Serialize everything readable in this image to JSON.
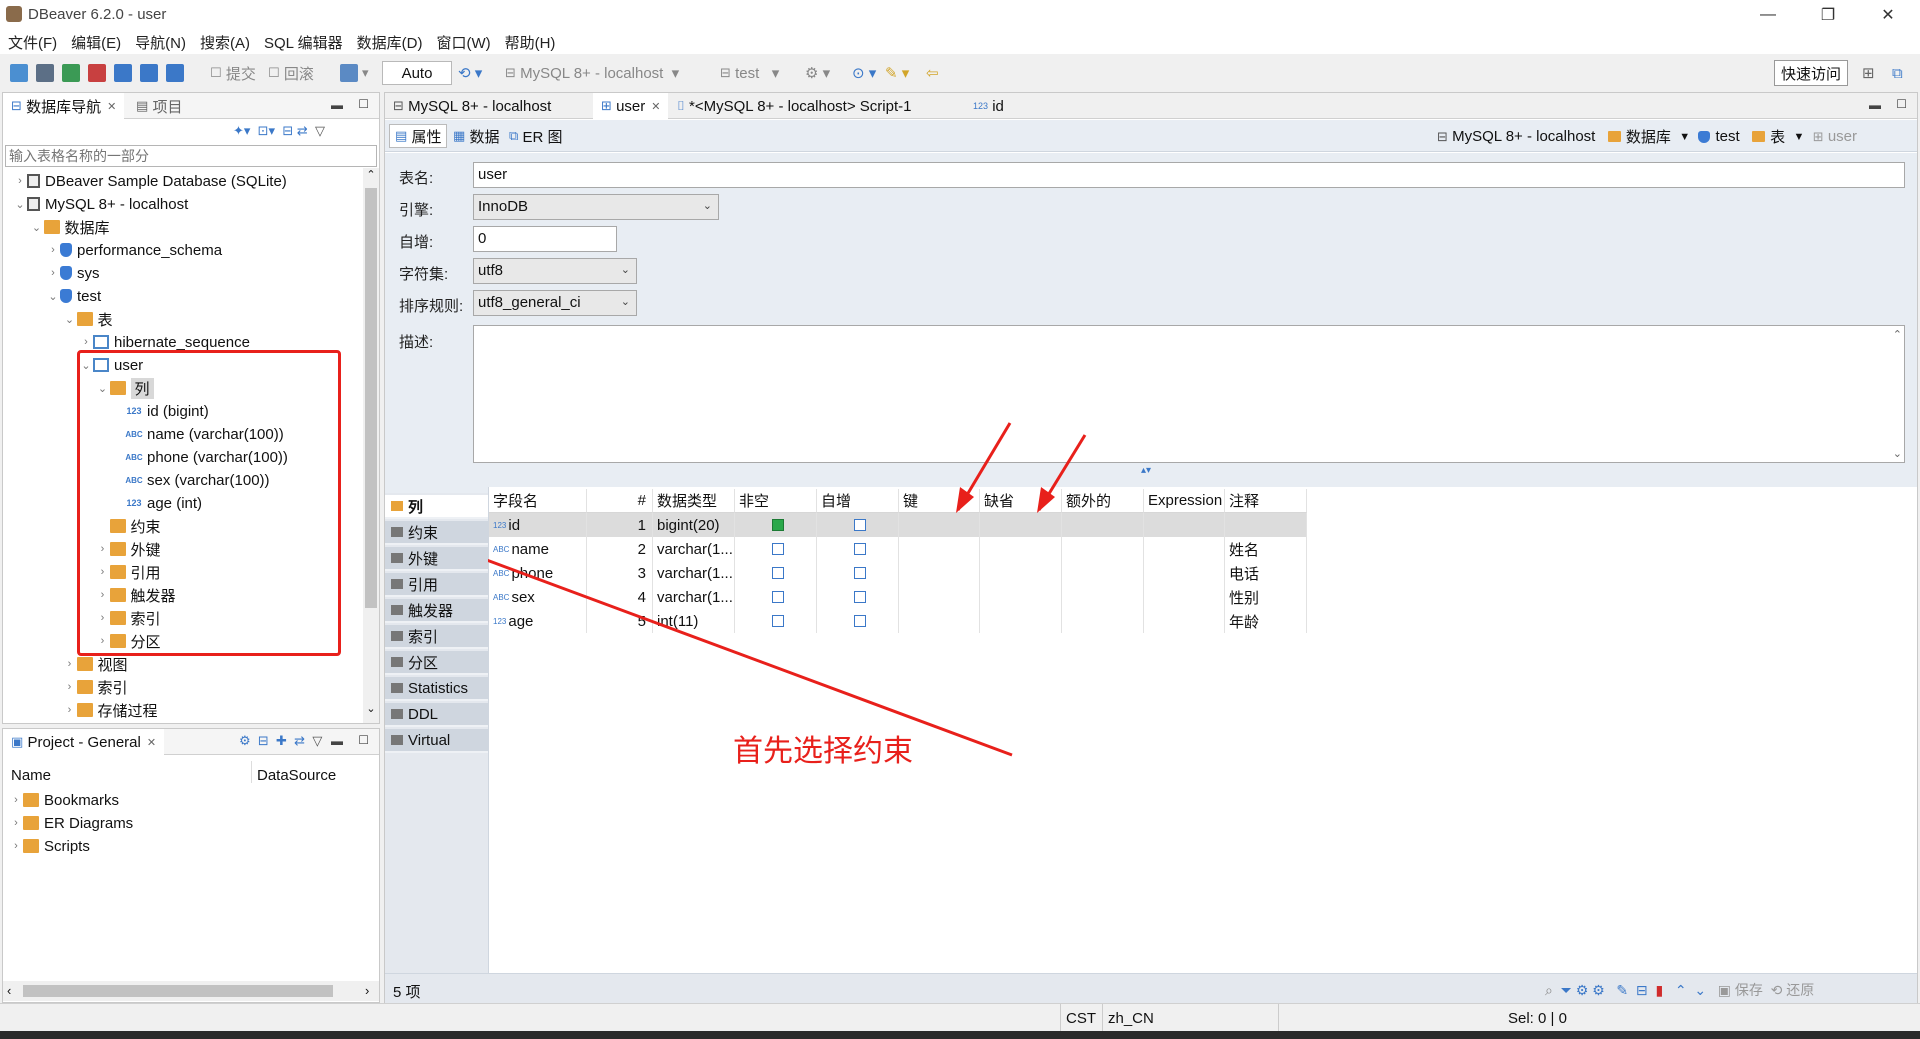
{
  "window": {
    "title": "DBeaver 6.2.0 - user"
  },
  "menu": [
    "文件(F)",
    "编辑(E)",
    "导航(N)",
    "搜索(A)",
    "SQL 编辑器",
    "数据库(D)",
    "窗口(W)",
    "帮助(H)"
  ],
  "toolbar": {
    "commit": "提交",
    "rollback": "回滚",
    "mode": "Auto",
    "connection": "MySQL 8+ - localhost",
    "database": "test",
    "quick_access": "快速访问"
  },
  "navigator": {
    "tab_label": "数据库导航",
    "project_tab": "项目",
    "filter_placeholder": "输入表格名称的一部分",
    "tree": [
      {
        "label": "DBeaver Sample Database (SQLite)",
        "level": 0,
        "arrow": "›",
        "icon": "conn"
      },
      {
        "label": "MySQL 8+ - localhost",
        "level": 0,
        "arrow": "⌄",
        "icon": "conn"
      },
      {
        "label": "数据库",
        "level": 1,
        "arrow": "⌄",
        "icon": "folder"
      },
      {
        "label": "performance_schema",
        "level": 2,
        "arrow": "›",
        "icon": "db"
      },
      {
        "label": "sys",
        "level": 2,
        "arrow": "›",
        "icon": "db"
      },
      {
        "label": "test",
        "level": 2,
        "arrow": "⌄",
        "icon": "db"
      },
      {
        "label": "表",
        "level": 3,
        "arrow": "⌄",
        "icon": "folder"
      },
      {
        "label": "hibernate_sequence",
        "level": 4,
        "arrow": "›",
        "icon": "table"
      },
      {
        "label": "user",
        "level": 4,
        "arrow": "⌄",
        "icon": "table"
      },
      {
        "label": "列",
        "level": 5,
        "arrow": "⌄",
        "icon": "folder"
      },
      {
        "label": "id (bigint)",
        "level": 6,
        "arrow": "",
        "icon": "num"
      },
      {
        "label": "name (varchar(100))",
        "level": 6,
        "arrow": "",
        "icon": "abc"
      },
      {
        "label": "phone (varchar(100))",
        "level": 6,
        "arrow": "",
        "icon": "abc"
      },
      {
        "label": "sex (varchar(100))",
        "level": 6,
        "arrow": "",
        "icon": "abc"
      },
      {
        "label": "age (int)",
        "level": 6,
        "arrow": "",
        "icon": "num"
      },
      {
        "label": "约束",
        "level": 5,
        "arrow": "",
        "icon": "folder"
      },
      {
        "label": "外键",
        "level": 5,
        "arrow": "›",
        "icon": "folder"
      },
      {
        "label": "引用",
        "level": 5,
        "arrow": "›",
        "icon": "folder"
      },
      {
        "label": "触发器",
        "level": 5,
        "arrow": "›",
        "icon": "folder"
      },
      {
        "label": "索引",
        "level": 5,
        "arrow": "›",
        "icon": "folder"
      },
      {
        "label": "分区",
        "level": 5,
        "arrow": "›",
        "icon": "folder"
      },
      {
        "label": "视图",
        "level": 3,
        "arrow": "›",
        "icon": "folder"
      },
      {
        "label": "索引",
        "level": 3,
        "arrow": "›",
        "icon": "folder"
      },
      {
        "label": "存储过程",
        "level": 3,
        "arrow": "›",
        "icon": "folder"
      }
    ]
  },
  "project": {
    "tab_label": "Project - General",
    "col_name": "Name",
    "col_datasource": "DataSource",
    "items": [
      "Bookmarks",
      "ER Diagrams",
      "Scripts"
    ]
  },
  "editor_tabs": [
    "MySQL 8+ - localhost",
    "user",
    "*<MySQL 8+ - localhost> Script-1",
    "id"
  ],
  "sub_tabs": [
    "属性",
    "数据",
    "ER 图"
  ],
  "breadcrumb": [
    "MySQL 8+ - localhost",
    "数据库",
    "test",
    "表",
    "user"
  ],
  "props": {
    "table_name_label": "表名:",
    "table_name": "user",
    "engine_label": "引擎:",
    "engine": "InnoDB",
    "autoinc_label": "自增:",
    "autoinc": "0",
    "charset_label": "字符集:",
    "charset": "utf8",
    "collation_label": "排序规则:",
    "collation": "utf8_general_ci",
    "desc_label": "描述:"
  },
  "side_tabs": [
    "列",
    "约束",
    "外键",
    "引用",
    "触发器",
    "索引",
    "分区",
    "Statistics",
    "DDL",
    "Virtual"
  ],
  "columns_grid": {
    "headers": [
      "字段名",
      "#",
      "数据类型",
      "非空",
      "自增",
      "键",
      "缺省",
      "额外的",
      "Expression",
      "注释"
    ],
    "rows": [
      {
        "name": "id",
        "num": "1",
        "type": "bigint(20)",
        "notnull": true,
        "autoinc": false,
        "comment": "",
        "icon": "123"
      },
      {
        "name": "name",
        "num": "2",
        "type": "varchar(1...",
        "notnull": false,
        "autoinc": false,
        "comment": "姓名",
        "icon": "ABC"
      },
      {
        "name": "phone",
        "num": "3",
        "type": "varchar(1...",
        "notnull": false,
        "autoinc": false,
        "comment": "电话",
        "icon": "ABC"
      },
      {
        "name": "sex",
        "num": "4",
        "type": "varchar(1...",
        "notnull": false,
        "autoinc": false,
        "comment": "性别",
        "icon": "ABC"
      },
      {
        "name": "age",
        "num": "5",
        "type": "int(11)",
        "notnull": false,
        "autoinc": false,
        "comment": "年龄",
        "icon": "123"
      }
    ]
  },
  "annotation": "首先选择约束",
  "footer": {
    "count": "5 项",
    "save": "保存",
    "revert": "还原"
  },
  "status": {
    "tz": "CST",
    "locale": "zh_CN",
    "sel": "Sel: 0 | 0"
  },
  "colors": {
    "annotation_red": "#e8201b",
    "side_tab_bg": "#cfd6df",
    "selected_row": "#dcdcdc"
  }
}
